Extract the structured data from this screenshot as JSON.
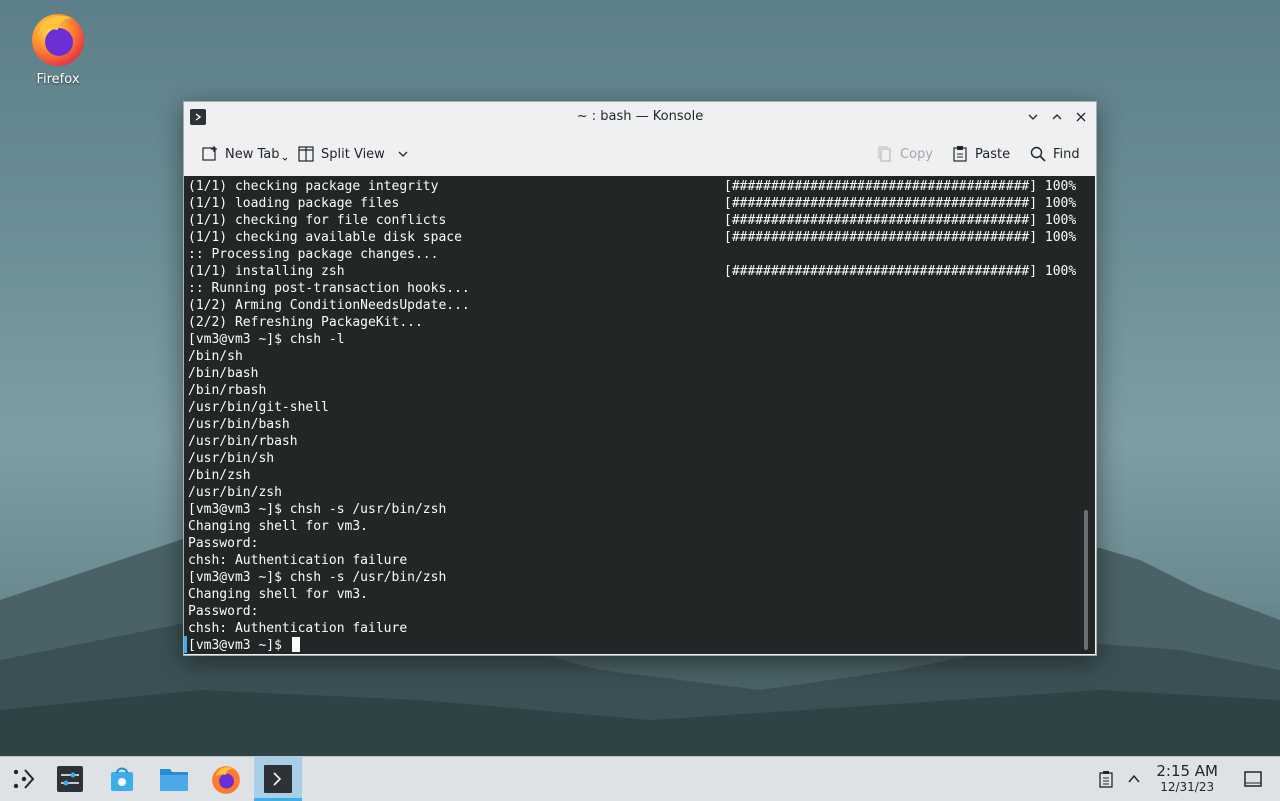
{
  "desktop": {
    "icons": [
      {
        "label": "Firefox",
        "icon": "firefox-icon"
      }
    ]
  },
  "window": {
    "title": "~ : bash — Konsole",
    "toolbar": {
      "new_tab": "New Tab",
      "split_view": "Split View",
      "copy": "Copy",
      "paste": "Paste",
      "find": "Find"
    }
  },
  "terminal": {
    "lines": [
      {
        "left": "(1/1) checking package integrity",
        "right": "[######################################] 100%"
      },
      {
        "left": "(1/1) loading package files",
        "right": "[######################################] 100%"
      },
      {
        "left": "(1/1) checking for file conflicts",
        "right": "[######################################] 100%"
      },
      {
        "left": "(1/1) checking available disk space",
        "right": "[######################################] 100%"
      },
      {
        "left": ":: Processing package changes...",
        "right": ""
      },
      {
        "left": "(1/1) installing zsh",
        "right": "[######################################] 100%"
      },
      {
        "left": ":: Running post-transaction hooks...",
        "right": ""
      },
      {
        "left": "(1/2) Arming ConditionNeedsUpdate...",
        "right": ""
      },
      {
        "left": "(2/2) Refreshing PackageKit...",
        "right": ""
      },
      {
        "left": "[vm3@vm3 ~]$ chsh -l",
        "right": ""
      },
      {
        "left": "/bin/sh",
        "right": ""
      },
      {
        "left": "/bin/bash",
        "right": ""
      },
      {
        "left": "/bin/rbash",
        "right": ""
      },
      {
        "left": "/usr/bin/git-shell",
        "right": ""
      },
      {
        "left": "/usr/bin/bash",
        "right": ""
      },
      {
        "left": "/usr/bin/rbash",
        "right": ""
      },
      {
        "left": "/usr/bin/sh",
        "right": ""
      },
      {
        "left": "/bin/zsh",
        "right": ""
      },
      {
        "left": "/usr/bin/zsh",
        "right": ""
      },
      {
        "left": "[vm3@vm3 ~]$ chsh -s /usr/bin/zsh",
        "right": ""
      },
      {
        "left": "Changing shell for vm3.",
        "right": ""
      },
      {
        "left": "Password:",
        "right": ""
      },
      {
        "left": "chsh: Authentication failure",
        "right": ""
      },
      {
        "left": "[vm3@vm3 ~]$ chsh -s /usr/bin/zsh",
        "right": ""
      },
      {
        "left": "Changing shell for vm3.",
        "right": ""
      },
      {
        "left": "Password:",
        "right": ""
      },
      {
        "left": "chsh: Authentication failure",
        "right": ""
      }
    ],
    "prompt": "[vm3@vm3 ~]$ "
  },
  "taskbar": {
    "launcher_icon": "application-launcher-icon",
    "tasks": [
      {
        "icon": "system-settings-icon"
      },
      {
        "icon": "discover-store-icon"
      },
      {
        "icon": "file-manager-icon"
      },
      {
        "icon": "firefox-icon"
      },
      {
        "icon": "konsole-icon",
        "active": true
      }
    ],
    "clock": {
      "time": "2:15 AM",
      "date": "12/31/23"
    }
  },
  "colors": {
    "accent": "#3daee9",
    "terminal_bg": "#232627",
    "terminal_fg": "#fcfcfc",
    "window_bg": "#eff0f1",
    "taskbar_bg": "#dfe2e5"
  }
}
